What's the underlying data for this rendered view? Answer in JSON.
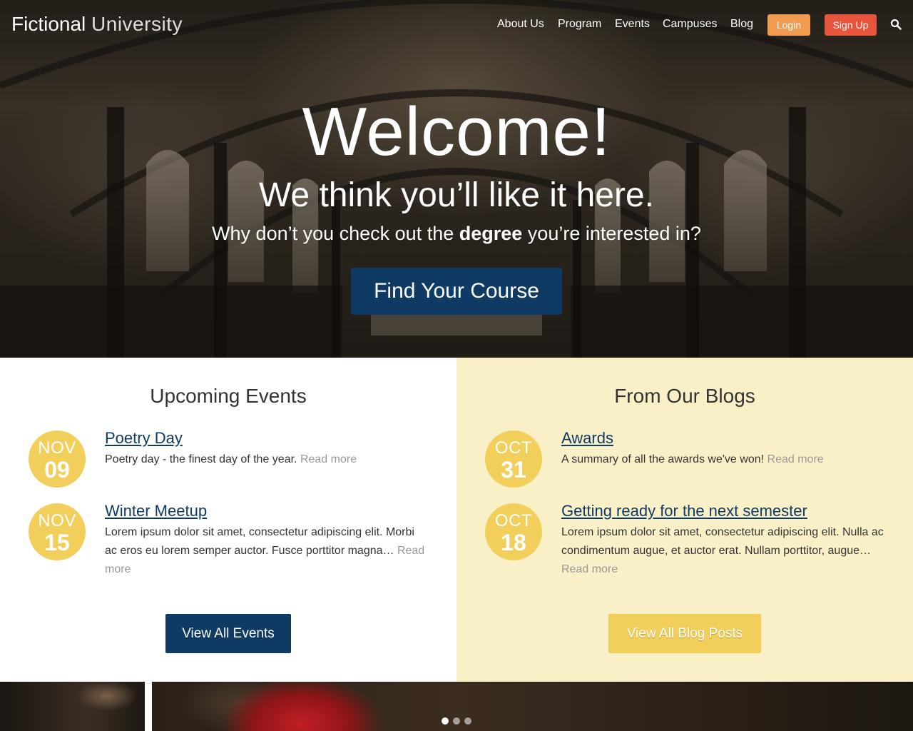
{
  "header": {
    "logo_strong": "Fictional",
    "logo_light": "University",
    "nav": [
      "About Us",
      "Program",
      "Events",
      "Campuses",
      "Blog"
    ],
    "login_label": "Login",
    "signup_label": "Sign Up",
    "search_icon": "search-icon"
  },
  "hero": {
    "title": "Welcome!",
    "subtitle": "We think you’ll like it here.",
    "tagline_before": "Why don’t you check out the ",
    "tagline_bold": "degree",
    "tagline_after": " you’re interested in?",
    "cta_label": "Find Your Course"
  },
  "events": {
    "heading": "Upcoming Events",
    "items": [
      {
        "month": "NOV",
        "day": "09",
        "title": "Poetry Day",
        "text": "Poetry day - the finest day of the year. ",
        "read_more": "Read more"
      },
      {
        "month": "NOV",
        "day": "15",
        "title": "Winter Meetup",
        "text": "Lorem ipsum dolor sit amet, consectetur adipiscing elit. Morbi ac eros eu lorem semper auctor. Fusce porttitor magna… ",
        "read_more": "Read more"
      }
    ],
    "button_label": "View All Events"
  },
  "blogs": {
    "heading": "From Our Blogs",
    "items": [
      {
        "month": "OCT",
        "day": "31",
        "title": "Awards",
        "text": "A summary of all the awards we've won! ",
        "read_more": "Read more"
      },
      {
        "month": "OCT",
        "day": "18",
        "title": "Getting ready for the next semester",
        "text": "Lorem ipsum dolor sit amet, consectetur adipiscing elit. Nulla ac condimentum augue, et auctor erat. Nullam porttitor, augue… ",
        "read_more": "Read more"
      }
    ],
    "button_label": "View All Blog Posts"
  },
  "slider": {
    "slide_count": 3,
    "active_slide": 1
  },
  "colors": {
    "primary": "#0f3a64",
    "accent_yellow": "#f2cf5b",
    "login_orange": "#f09b4f",
    "signup_red": "#e8553d",
    "blog_bg": "#f9f0c8"
  }
}
